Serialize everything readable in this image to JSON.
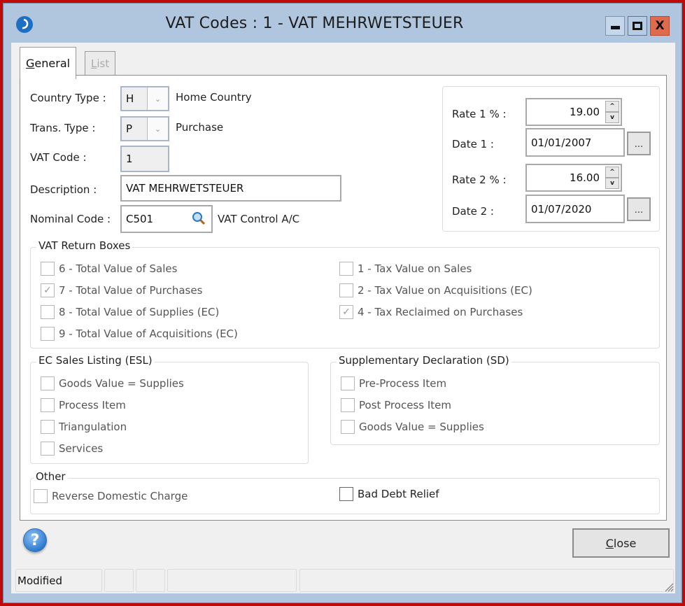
{
  "window": {
    "title": "VAT Codes : 1 - VAT MEHRWETSTEUER",
    "app_icon": "app-logo-icon",
    "controls": {
      "minimize": "minimize-icon",
      "maximize": "maximize-icon",
      "close": "X"
    }
  },
  "tabs": [
    {
      "label_accel": "G",
      "label_rest": "eneral",
      "active": true
    },
    {
      "label_accel": "L",
      "label_rest": "ist",
      "active": false
    }
  ],
  "form": {
    "country_type": {
      "label": "Country Type :",
      "value": "H",
      "description": "Home Country"
    },
    "trans_type": {
      "label": "Trans. Type :",
      "value": "P",
      "description": "Purchase"
    },
    "vat_code": {
      "label": "VAT Code :",
      "value": "1"
    },
    "description": {
      "label": "Description :",
      "value": "VAT MEHRWETSTEUER"
    },
    "nominal_code": {
      "label": "Nominal Code :",
      "value": "C501",
      "description": "VAT  Control A/C"
    }
  },
  "rates": {
    "rate1": {
      "label": "Rate 1 % :",
      "value": "19.00"
    },
    "date1": {
      "label": "Date 1 :",
      "value": "01/01/2007"
    },
    "rate2": {
      "label": "Rate 2 % :",
      "value": "16.00"
    },
    "date2": {
      "label": "Date 2 :",
      "value": "01/07/2020"
    },
    "ellipsis": "...",
    "spin_up": "^",
    "spin_down": "v"
  },
  "vat_return_boxes": {
    "title": "VAT Return Boxes",
    "left": [
      {
        "label": "6 - Total Value of Sales",
        "checked": false
      },
      {
        "label": "7 - Total Value of Purchases",
        "checked": true
      },
      {
        "label": "8 - Total Value of Supplies (EC)",
        "checked": false
      },
      {
        "label": "9 - Total Value of Acquisitions (EC)",
        "checked": false
      }
    ],
    "right": [
      {
        "label": "1 - Tax Value on Sales",
        "checked": false
      },
      {
        "label": "2 - Tax Value on Acquisitions (EC)",
        "checked": false
      },
      {
        "label": "4 - Tax Reclaimed on Purchases",
        "checked": true
      }
    ]
  },
  "esl": {
    "title": "EC Sales Listing (ESL)",
    "items": [
      {
        "label": "Goods Value = Supplies",
        "checked": false
      },
      {
        "label": "Process Item",
        "checked": false
      },
      {
        "label": "Triangulation",
        "checked": false
      },
      {
        "label": "Services",
        "checked": false
      }
    ]
  },
  "sd": {
    "title": "Supplementary Declaration (SD)",
    "items": [
      {
        "label": "Pre-Process Item",
        "checked": false
      },
      {
        "label": "Post Process Item",
        "checked": false
      },
      {
        "label": "Goods Value = Supplies",
        "checked": false
      }
    ]
  },
  "other": {
    "title": "Other",
    "reverse_domestic_charge": {
      "label": "Reverse Domestic Charge",
      "checked": false
    },
    "bad_debt_relief": {
      "label": "Bad Debt Relief",
      "checked": false
    }
  },
  "footer": {
    "help": "?",
    "close_accel": "C",
    "close_rest": "lose"
  },
  "statusbar": {
    "cells": [
      "Modified",
      "",
      "",
      "",
      ""
    ]
  },
  "check_mark": "✓",
  "colors": {
    "frame": "#c00a0a",
    "titlebar": "#b0c6df",
    "close": "#e06a4e"
  }
}
